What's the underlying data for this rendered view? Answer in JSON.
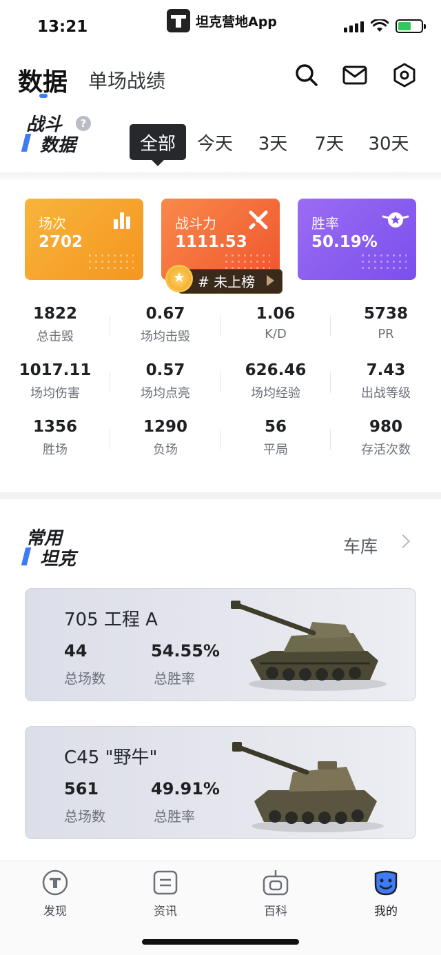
{
  "status_bar": {
    "time": "13:21",
    "app_name": "坦克营地App"
  },
  "header": {
    "tab_active": "数据",
    "tab_inactive": "单场战绩",
    "icons": [
      "search-icon",
      "mail-icon",
      "settings-icon"
    ]
  },
  "battle": {
    "title_line1": "战斗",
    "title_line2": "数据",
    "help": "?",
    "ranges": [
      "全部",
      "今天",
      "3天",
      "7天",
      "30天"
    ],
    "selected_range": "全部"
  },
  "cards": [
    {
      "label": "场次",
      "value": "2702",
      "color": "#f6a22b",
      "icon": "bar-chart-icon"
    },
    {
      "label": "战斗力",
      "value": "1111.53",
      "color": "#f46a3c",
      "icon": "swords-icon"
    },
    {
      "label": "胜率",
      "value": "50.19%",
      "color": "#8a5cf0",
      "icon": "star-badge-icon"
    }
  ],
  "rank": {
    "text": "# 未上榜"
  },
  "stats": [
    {
      "value": "1822",
      "label": "总击毁"
    },
    {
      "value": "0.67",
      "label": "场均击毁"
    },
    {
      "value": "1.06",
      "label": "K/D"
    },
    {
      "value": "5738",
      "label": "PR"
    },
    {
      "value": "1017.11",
      "label": "场均伤害"
    },
    {
      "value": "0.57",
      "label": "场均点亮"
    },
    {
      "value": "626.46",
      "label": "场均经验"
    },
    {
      "value": "7.43",
      "label": "出战等级"
    },
    {
      "value": "1356",
      "label": "胜场"
    },
    {
      "value": "1290",
      "label": "负场"
    },
    {
      "value": "56",
      "label": "平局"
    },
    {
      "value": "980",
      "label": "存活次数"
    }
  ],
  "tanks_section": {
    "title_line1": "常用",
    "title_line2": "坦克",
    "garage_link": "车库",
    "tanks": [
      {
        "name": "705 工程 A",
        "battles": "44",
        "battles_label": "总场数",
        "winrate": "54.55%",
        "winrate_label": "总胜率"
      },
      {
        "name": "C45 \"野牛\"",
        "battles": "561",
        "battles_label": "总场数",
        "winrate": "49.91%",
        "winrate_label": "总胜率"
      }
    ]
  },
  "bottom_nav": [
    {
      "label": "发现",
      "icon": "discover-icon"
    },
    {
      "label": "资讯",
      "icon": "news-icon"
    },
    {
      "label": "百科",
      "icon": "wiki-icon"
    },
    {
      "label": "我的",
      "icon": "profile-icon",
      "active": true
    }
  ]
}
